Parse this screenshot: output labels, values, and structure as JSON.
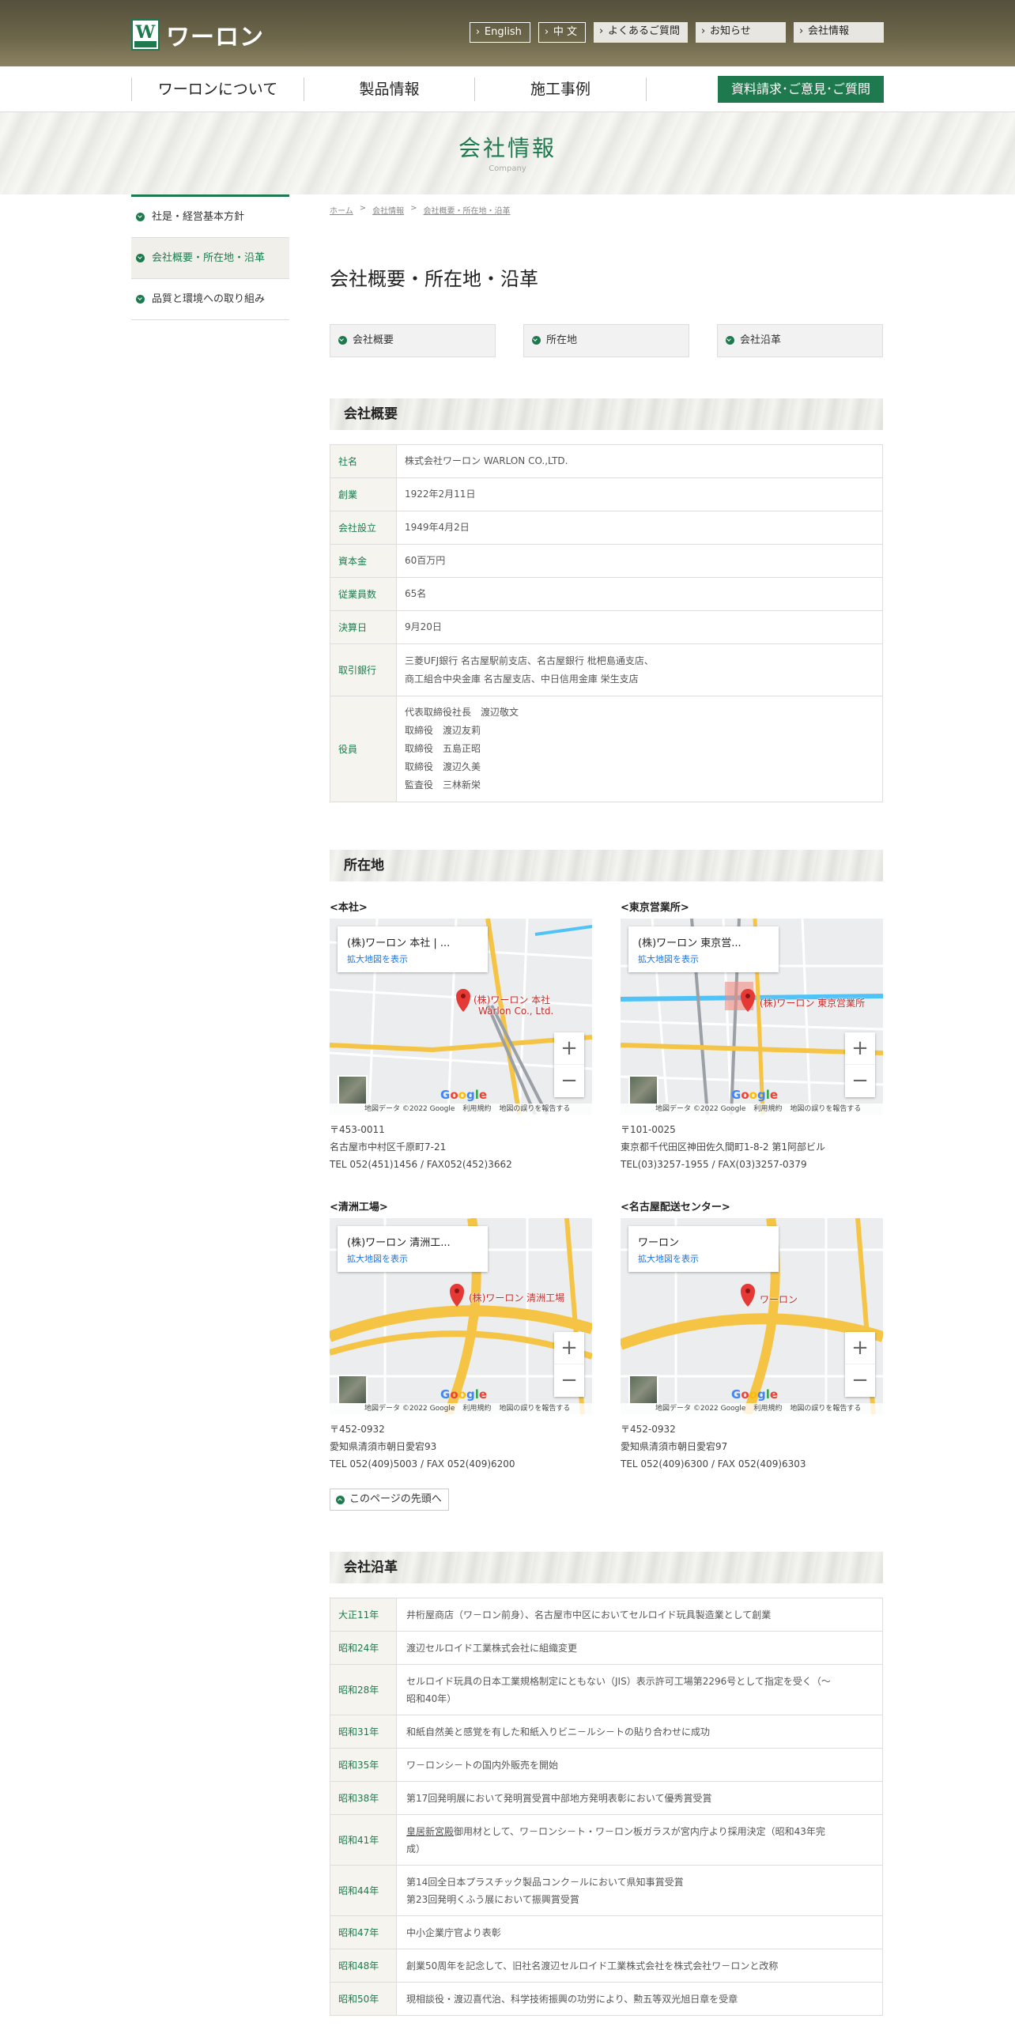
{
  "header": {
    "logo_text": "ワーロン",
    "top_links": [
      {
        "label": "English",
        "style": "outline"
      },
      {
        "label": "中 文",
        "style": "outline"
      },
      {
        "label": "よくあるご質問",
        "style": "solid"
      },
      {
        "label": "お知らせ",
        "style": "solid"
      },
      {
        "label": "会社情報",
        "style": "solid"
      }
    ],
    "nav": [
      "ワーロンについて",
      "製品情報",
      "施工事例"
    ],
    "cta": "資料請求･ご意見･ご質問"
  },
  "hero": {
    "title": "会社情報",
    "subtitle": "Company"
  },
  "sidebar": {
    "items": [
      {
        "label": "社是・経営基本方針",
        "active": false
      },
      {
        "label": "会社概要・所在地・沿革",
        "active": true
      },
      {
        "label": "品質と環境への取り組み",
        "active": false
      }
    ]
  },
  "breadcrumb": [
    "ホーム",
    "会社情報",
    "会社概要・所在地・沿革"
  ],
  "page_title": "会社概要・所在地・沿革",
  "anchors": [
    "会社概要",
    "所在地",
    "会社沿革"
  ],
  "overview": {
    "heading": "会社概要",
    "rows": [
      {
        "key": "社名",
        "lines": [
          "株式会社ワーロン WARLON CO.,LTD."
        ]
      },
      {
        "key": "創業",
        "lines": [
          "1922年2月11日"
        ]
      },
      {
        "key": "会社設立",
        "lines": [
          "1949年4月2日"
        ]
      },
      {
        "key": "資本金",
        "lines": [
          "60百万円"
        ]
      },
      {
        "key": "従業員数",
        "lines": [
          "65名"
        ]
      },
      {
        "key": "決算日",
        "lines": [
          "9月20日"
        ]
      },
      {
        "key": "取引銀行",
        "lines": [
          "三菱UFJ銀行 名古屋駅前支店、名古屋銀行 枇杷島通支店、",
          "商工組合中央金庫 名古屋支店、中日信用金庫 栄生支店"
        ]
      },
      {
        "key": "役員",
        "lines": [
          "代表取締役社長　渡辺敬文",
          "取締役　渡辺友莉",
          "取締役　五島正昭",
          "取締役　渡辺久美",
          "監査役　三林新栄"
        ]
      }
    ]
  },
  "locations": {
    "heading": "所在地",
    "map_link": "拡大地図を表示",
    "map_footer": [
      "地図データ ©2022 Google",
      "利用規約",
      "地図の誤りを報告する"
    ],
    "items": [
      {
        "label": "<本社>",
        "card_title": "(株)ワーロン 本社 | ...",
        "pin": "(株)ワーロン 本社",
        "pin2": "Warlon Co., Ltd.",
        "postal": "〒453-0011",
        "address": "名古屋市中村区千原町7-21",
        "tel": "TEL 052(451)1456 / FAX052(452)3662"
      },
      {
        "label": "<東京営業所>",
        "card_title": "(株)ワーロン 東京営...",
        "pin": "(株)ワーロン 東京営業所",
        "pin2": "",
        "postal": "〒101-0025",
        "address": "東京都千代田区神田佐久間町1-8-2 第1阿部ビル",
        "tel": "TEL(03)3257-1955 / FAX(03)3257-0379"
      },
      {
        "label": "<清洲工場>",
        "card_title": "(株)ワーロン 清洲工...",
        "pin": "(株)ワーロン 清洲工場",
        "pin2": "",
        "postal": "〒452-0932",
        "address": "愛知県清須市朝日愛宕93",
        "tel": "TEL 052(409)5003 / FAX 052(409)6200"
      },
      {
        "label": "<名古屋配送センター>",
        "card_title": "ワーロン",
        "pin": "ワーロン",
        "pin2": "",
        "postal": "〒452-0932",
        "address": "愛知県清須市朝日愛宕97",
        "tel": "TEL 052(409)6300 / FAX 052(409)6303"
      }
    ],
    "to_top": "このページの先頭へ"
  },
  "history": {
    "heading": "会社沿革",
    "rows": [
      {
        "key": "大正11年",
        "lines": [
          "井桁屋商店（ワ－ロン前身）、名古屋市中区においてセルロイド玩具製造業として創業"
        ]
      },
      {
        "key": "昭和24年",
        "lines": [
          "渡辺セルロイド工業株式会社に組織変更"
        ]
      },
      {
        "key": "昭和28年",
        "lines": [
          "セルロイド玩具の日本工業規格制定にともない（JIS）表示許可工場第2296号として指定を受く（～",
          "昭和40年）"
        ]
      },
      {
        "key": "昭和31年",
        "lines": [
          "和紙自然美と感覚を有した和紙入りビニ－ルシ－トの貼り合わせに成功"
        ]
      },
      {
        "key": "昭和35年",
        "lines": [
          "ワ－ロンシ－トの国内外販売を開始"
        ]
      },
      {
        "key": "昭和38年",
        "lines": [
          "第17回発明展において発明賞受賞中部地方発明表彰において優秀賞受賞"
        ]
      },
      {
        "key": "昭和41年",
        "underline": "皇居新宮殿",
        "lines": [
          "御用材として、ワ－ロンシ－ト・ワ－ロン板ガラスが宮内庁より採用決定（昭和43年完",
          "成）"
        ]
      },
      {
        "key": "昭和44年",
        "lines": [
          "第14回全日本プラスチック製品コンク－ルにおいて県知事賞受賞",
          "第23回発明くふう展において振興賞受賞"
        ]
      },
      {
        "key": "昭和47年",
        "lines": [
          "中小企業庁官より表彰"
        ]
      },
      {
        "key": "昭和48年",
        "lines": [
          "創業50周年を記念して、旧社名渡辺セルロイド工業株式会社を株式会社ワ－ロンと改称"
        ]
      },
      {
        "key": "昭和50年",
        "lines": [
          "現相談役・渡辺喜代治、科学技術振興の功労により、勲五等双光旭日章を受章"
        ]
      }
    ]
  }
}
